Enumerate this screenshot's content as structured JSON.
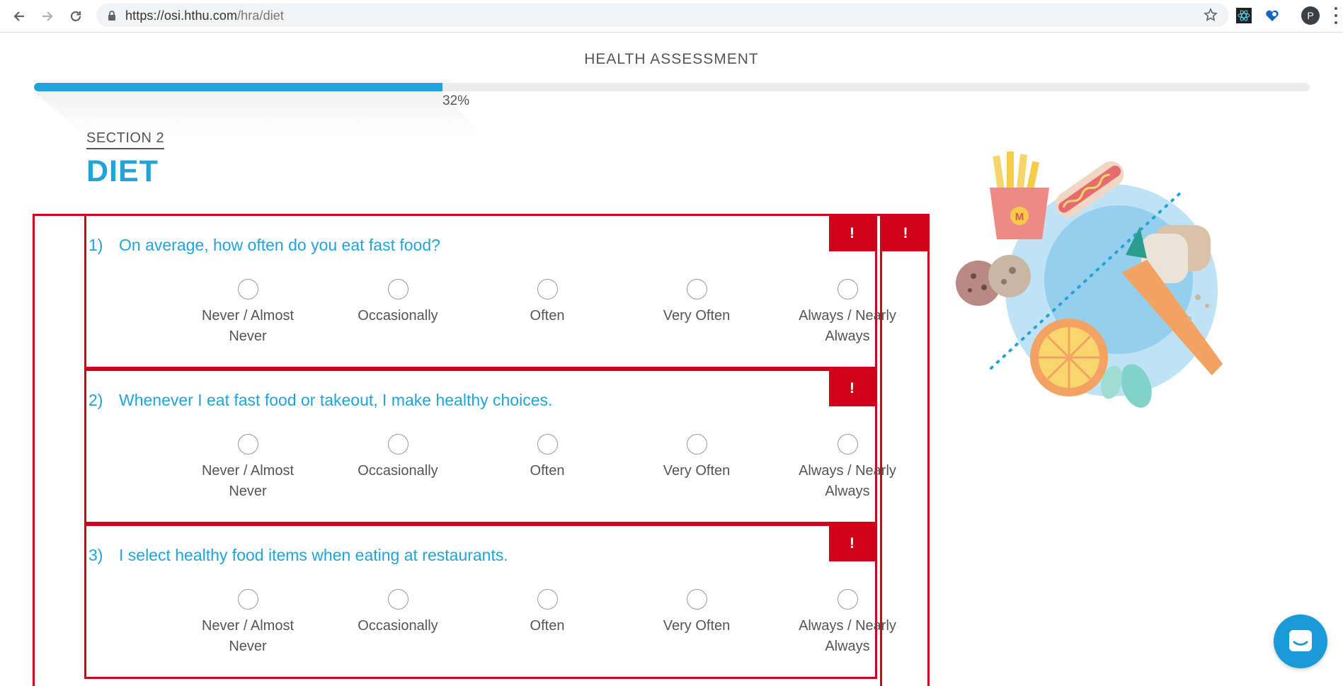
{
  "browser": {
    "url_host": "https://osi.hthu.com",
    "url_path": "/hra/diet",
    "profile_initial": "P"
  },
  "header": {
    "title": "HEALTH ASSESSMENT",
    "progress_percent": 32,
    "progress_label": "32%"
  },
  "section": {
    "label": "SECTION 2",
    "title": "DIET"
  },
  "flags": {
    "error_symbol": "!"
  },
  "options": [
    "Never / Almost Never",
    "Occasionally",
    "Often",
    "Very Often",
    "Always / Nearly Always"
  ],
  "questions": [
    {
      "number": "1)",
      "text": "On average, how often do you eat fast food?",
      "options": [
        {
          "line1": "Never / Almost",
          "line2": "Never"
        },
        {
          "line1": "Occasionally",
          "line2": ""
        },
        {
          "line1": "Often",
          "line2": ""
        },
        {
          "line1": "Very Often",
          "line2": ""
        },
        {
          "line1": "Always / Nearly",
          "line2": "Always"
        }
      ]
    },
    {
      "number": "2)",
      "text": "Whenever I eat fast food or takeout, I make healthy choices.",
      "options": [
        {
          "line1": "Never / Almost",
          "line2": "Never"
        },
        {
          "line1": "Occasionally",
          "line2": ""
        },
        {
          "line1": "Often",
          "line2": ""
        },
        {
          "line1": "Very Often",
          "line2": ""
        },
        {
          "line1": "Always / Nearly",
          "line2": "Always"
        }
      ]
    },
    {
      "number": "3)",
      "text": "I select healthy food items when eating at restaurants.",
      "options": [
        {
          "line1": "Never / Almost",
          "line2": "Never"
        },
        {
          "line1": "Occasionally",
          "line2": ""
        },
        {
          "line1": "Often",
          "line2": ""
        },
        {
          "line1": "Very Often",
          "line2": ""
        },
        {
          "line1": "Always / Nearly",
          "line2": "Always"
        }
      ]
    }
  ],
  "fries_logo_letter": "M",
  "colors": {
    "accent": "#21a3dc",
    "error": "#d0021b",
    "progress_track": "#ececec"
  }
}
